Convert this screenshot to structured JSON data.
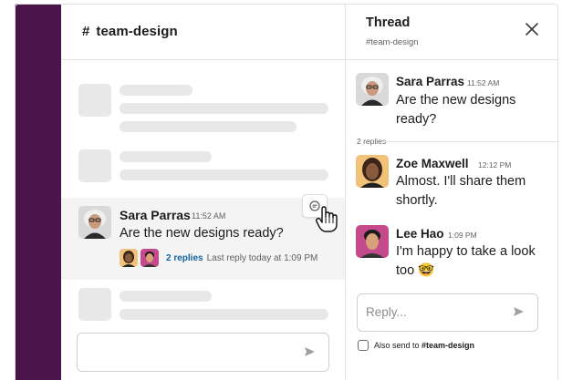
{
  "app": {
    "accent_color": "#4a154b",
    "link_color": "#1264a3"
  },
  "channel": {
    "hash": "#",
    "name": "team-design",
    "message": {
      "author": "Sara Parras",
      "time": "11:52 AM",
      "text": "Are the new designs ready?",
      "reply_count": "2 replies",
      "reply_meta": "Last reply today at 1:09 PM"
    },
    "action_icon": "reply-in-thread-icon",
    "composer_icon": "send-icon"
  },
  "thread": {
    "title": "Thread",
    "subtitle": "#team-design",
    "close_icon": "close-icon",
    "divider_label": "2 replies",
    "messages": [
      {
        "author": "Sara Parras",
        "time": "11:52 AM",
        "text": "Are the new designs ready?"
      },
      {
        "author": "Zoe Maxwell",
        "time": "12:12 PM",
        "text": "Almost. I'll share them shortly."
      },
      {
        "author": "Lee Hao",
        "time": "1:09 PM",
        "text": "I'm happy to take a look too",
        "emoji": "🤓"
      }
    ],
    "reply_placeholder": "Reply...",
    "also_send_prefix": "Also send to ",
    "also_send_channel": "#team-design"
  }
}
